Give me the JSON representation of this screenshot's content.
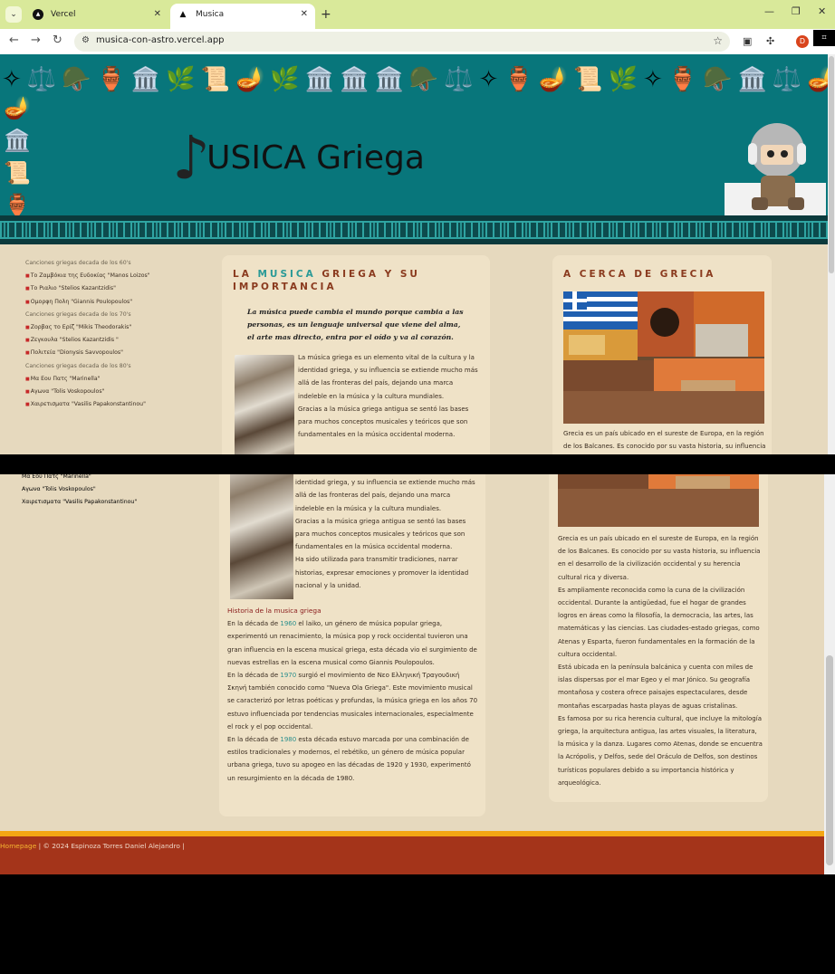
{
  "browser": {
    "tabs": [
      {
        "title": "Vercel"
      },
      {
        "title": "Musica"
      }
    ],
    "url": "musica-con-astro.vercel.app",
    "profile_initial": "D"
  },
  "header": {
    "logo_text": "USICA Griega",
    "logo_letter_note": "♪"
  },
  "sidebar": {
    "groups": [
      {
        "label": "Canciones griegas decada de los 60's",
        "songs": [
          "Το Ζαμβόκια της Ευδοκίας \"Manos Loizos\"",
          "Το Ριαλιο \"Stelios Kazantzidis\"",
          "Ομορφη Πολη \"Giannis Poulopoulos\""
        ]
      },
      {
        "label": "Canciones griegas decada de los 70's",
        "songs": [
          "Ζορβας το Ερίζ \"Mikis Theodorakis\"",
          "Ζεγκουλα \"Stelios Kazantzidis \"",
          "Πολιτεία \"Dionysis Savvopoulos\""
        ]
      },
      {
        "label": "Canciones griegas decada de los 80's",
        "songs": [
          "Μα Εου Πατς \"Marinella\"",
          "Αγωνα \"Tolis Voskopoulos\"",
          "Χαιρετισματα \"Vasilis Papakonstantinou\""
        ]
      }
    ]
  },
  "card_music": {
    "title_pre": "LA ",
    "title_hl": "MUSICA",
    "title_post": " GRIEGA Y SU IMPORTANCIA",
    "quote": "La música puede cambia el mundo porque cambia a las personas, es un lenguaje universal que viene del alma, el arte mas directo, entra por el oído y va al corazón.",
    "paragraphs": [
      "La música griega es un elemento vital de la cultura y la identidad griega, y su influencia se extiende mucho más allá de las fronteras del país, dejando una marca indeleble en la música y la cultura mundiales.",
      "Gracias a la música griega antigua se sentó las bases para muchos conceptos musicales y teóricos que son fundamentales en la música occidental moderna.",
      "Ha sido utilizada para transmitir tradiciones, narrar historias, expresar emociones y promover la identidad nacional y la unidad."
    ],
    "history_title": "Historia de la musica griega",
    "history": [
      {
        "pre": "En la década de ",
        "year": "1960",
        "post": " el laiko, un género de música popular griega, experimentó un renacimiento, la música pop y rock occidental tuvieron una gran influencia en la escena musical griega, esta década vio el surgimiento de nuevas estrellas en la escena musical como Giannis Poulopoulos."
      },
      {
        "pre": "En la década de ",
        "year": "1970",
        "post": " surgió el movimiento de Νεο Ελληνική Τραγουδική Σκηνή también conocido como \"Nueva Ola Griega\". Este movimiento musical se caracterizó por letras poéticas y profundas, la música griega en los años 70 estuvo influenciada por tendencias musicales internacionales, especialmente el rock y el pop occidental."
      },
      {
        "pre": "En la década de ",
        "year": "1980",
        "post": " esta década estuvo marcada por una combinación de estilos tradicionales y modernos, el rebétiko, un género de música popular urbana griega, tuvo su apogeo en las décadas de 1920 y 1930, experimentó un resurgimiento en la década de 1980."
      }
    ]
  },
  "card_greece": {
    "title": "A CERCA DE GRECIA",
    "paragraphs": [
      "Grecia es un país ubicado en el sureste de Europa, en la región de los Balcanes. Es conocido por su vasta historia, su influencia en el desarrollo de la civilización occidental y su herencia cultural rica y diversa.",
      "Es ampliamente reconocida como la cuna de la civilización occidental. Durante la antigüedad, fue el hogar de grandes logros en áreas como la filosofía, la democracia, las artes, las matemáticas y las ciencias. Las ciudades-estado griegas, como Atenas y Esparta, fueron fundamentales en la formación de la cultura occidental.",
      "Está ubicada en la península balcánica y cuenta con miles de islas dispersas por el mar Egeo y el mar Jónico. Su geografía montañosa y costera ofrece paisajes espectaculares, desde montañas escarpadas hasta playas de aguas cristalinas.",
      "Es famosa por su rica herencia cultural, que incluye la mitología griega, la arquitectura antigua, las artes visuales, la literatura, la música y la danza. Lugares como Atenas, donde se encuentra la Acrópolis, y Delfos, sede del Oráculo de Delfos, son destinos turísticos populares debido a su importancia histórica y arqueológica."
    ]
  },
  "footer": {
    "link": "Homepage",
    "text": " | © 2024 Espinoza Torres Daniel Alejandro |"
  },
  "colors": {
    "header_teal": "#08767b",
    "page_bg": "#e6d9be",
    "card_bg": "#efe2c7",
    "footer": "#a4341a",
    "accent_teal": "#2a9a97",
    "title_brown": "#8a3a1e"
  }
}
